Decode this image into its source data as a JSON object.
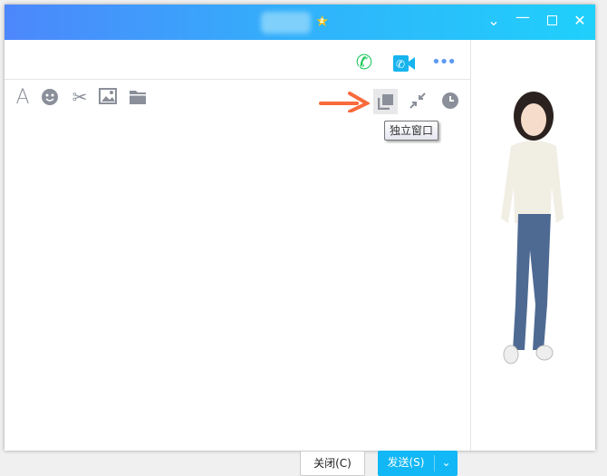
{
  "titlebar": {
    "badge": "z",
    "controls": [
      "dropdown",
      "minimize",
      "maximize",
      "close"
    ]
  },
  "header_actions": [
    "voice-call",
    "video-call",
    "more"
  ],
  "toolbar": {
    "left": [
      "font",
      "emoji",
      "screenshot",
      "image",
      "folder"
    ],
    "right": [
      "independent-window",
      "shrink",
      "history"
    ]
  },
  "tooltip": "独立窗口",
  "buttons": {
    "close": "关闭(C)",
    "send": "发送(S)"
  },
  "colors": {
    "accent": "#12b7f5",
    "arrow": "#f96a3c"
  }
}
